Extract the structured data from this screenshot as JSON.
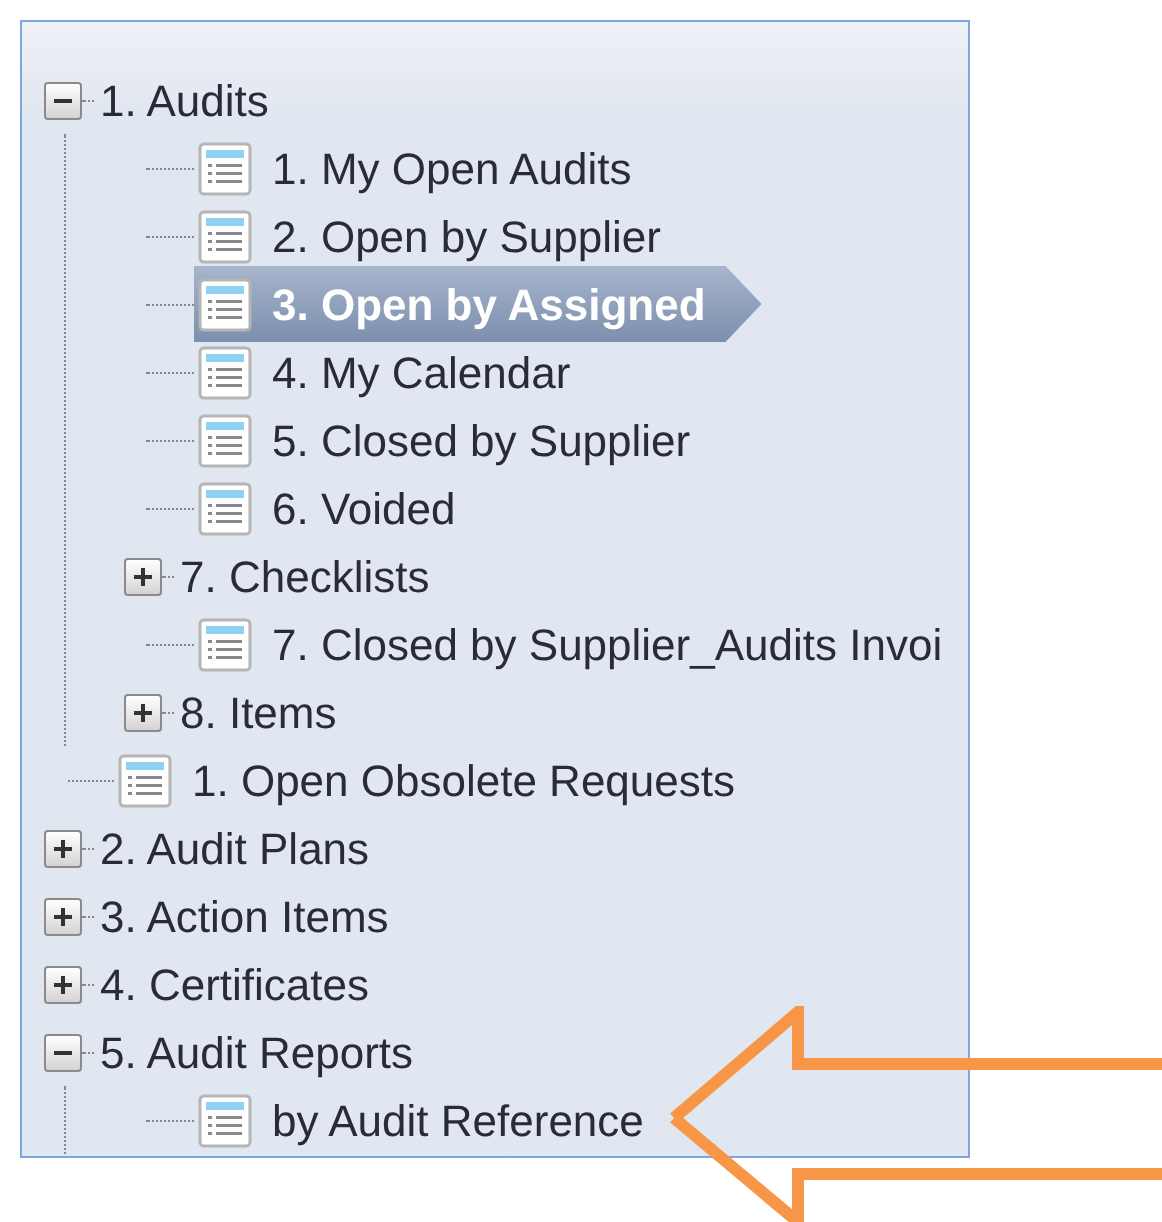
{
  "tree": [
    {
      "label": "1. Audits",
      "kind": "folder",
      "expanded": true,
      "children": [
        {
          "label": "1. My Open Audits",
          "kind": "leaf",
          "selected": false
        },
        {
          "label": "2. Open by Supplier",
          "kind": "leaf",
          "selected": false
        },
        {
          "label": "3. Open by Assigned",
          "kind": "leaf",
          "selected": true
        },
        {
          "label": "4. My Calendar",
          "kind": "leaf",
          "selected": false
        },
        {
          "label": "5. Closed by Supplier",
          "kind": "leaf",
          "selected": false
        },
        {
          "label": "6. Voided",
          "kind": "leaf",
          "selected": false
        },
        {
          "label": "7. Checklists",
          "kind": "folder",
          "expanded": false
        },
        {
          "label": "7. Closed by Supplier_Audits Invoi",
          "kind": "leaf",
          "selected": false
        },
        {
          "label": "8. Items",
          "kind": "folder",
          "expanded": false
        }
      ]
    },
    {
      "label": "1. Open Obsolete Requests",
      "kind": "leaf",
      "selected": false
    },
    {
      "label": "2. Audit Plans",
      "kind": "folder",
      "expanded": false
    },
    {
      "label": "3. Action Items",
      "kind": "folder",
      "expanded": false
    },
    {
      "label": "4. Certificates",
      "kind": "folder",
      "expanded": false
    },
    {
      "label": "5. Audit Reports",
      "kind": "folder",
      "expanded": true,
      "children": [
        {
          "label": "by Audit Reference",
          "kind": "leaf",
          "selected": false
        }
      ]
    }
  ]
}
